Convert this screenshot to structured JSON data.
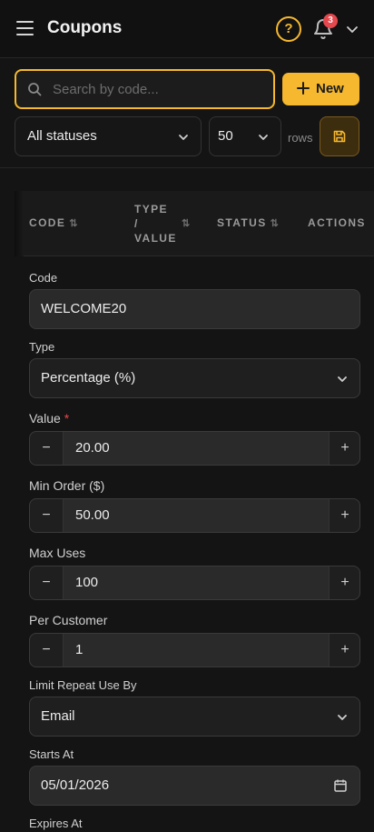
{
  "header": {
    "title": "Coupons",
    "help_label": "?",
    "notification_count": "3"
  },
  "toolbar": {
    "search_placeholder": "Search by code...",
    "new_label": "New",
    "status_filter": "All statuses",
    "rows_value": "50",
    "rows_label": "rows"
  },
  "table": {
    "columns": {
      "code": "CODE",
      "type_line1": "TYPE",
      "type_line2": "/",
      "type_line3": "VALUE",
      "status": "STATUS",
      "actions": "ACTIONS"
    },
    "sort_glyph": "⇅"
  },
  "form": {
    "code_label": "Code",
    "code_value": "WELCOME20",
    "type_label": "Type",
    "type_value": "Percentage (%)",
    "value_label": "Value",
    "value_required": "*",
    "value_value": "20.00",
    "min_order_label": "Min Order ($)",
    "min_order_value": "50.00",
    "max_uses_label": "Max Uses",
    "max_uses_value": "100",
    "per_customer_label": "Per Customer",
    "per_customer_value": "1",
    "limit_label": "Limit Repeat Use By",
    "limit_value": "Email",
    "starts_label": "Starts At",
    "starts_value": "05/01/2026",
    "expires_label": "Expires At",
    "minus_glyph": "−",
    "plus_glyph": "+"
  },
  "colors": {
    "accent": "#f5b82e",
    "badge": "#e5484d",
    "background": "#141414"
  }
}
